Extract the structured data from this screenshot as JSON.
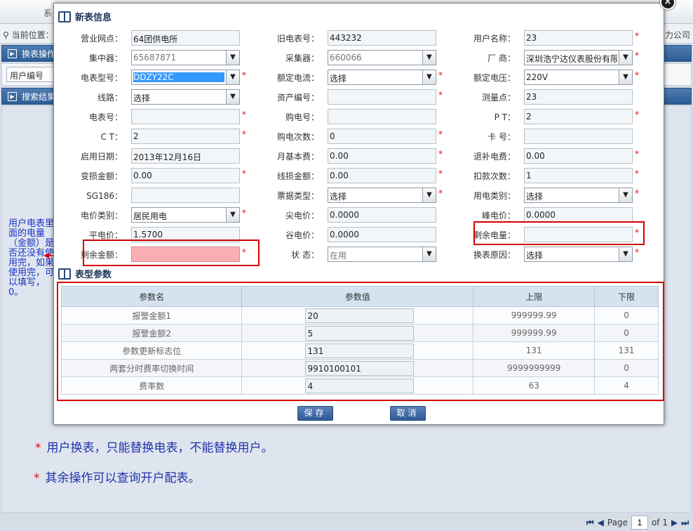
{
  "background": {
    "topbar_text": "系",
    "location_label": "当前位置：",
    "company_text": "力公司",
    "panel_replace": "换表操作",
    "field_user_no": "用户编号",
    "panel_search": "搜索结果",
    "annotation": "用户电表里面的电量（金额）是否还没有使用完，如果使用完，可以填写，0。",
    "note1": "用户换表，只能替换电表，不能替换用户。",
    "note2": "其余操作可以查询开户配表。",
    "pager": {
      "page_label": "Page",
      "page_value": "1",
      "of_label": "of 1"
    }
  },
  "modal": {
    "section1_title": "新表信息",
    "section2_title": "表型参数",
    "close_symbol": "×",
    "col1": [
      {
        "label": "营业网点：",
        "value": "64团供电所",
        "type": "input",
        "req": false
      },
      {
        "label": "集中器：",
        "value": "65687871",
        "type": "select",
        "gray": true,
        "req": false
      },
      {
        "label": "电表型号：",
        "value": "DDZY22C",
        "type": "select",
        "highlight": true,
        "req": true
      },
      {
        "label": "线路：",
        "value": "选择",
        "type": "select",
        "req": false
      },
      {
        "label": "电表号：",
        "value": "",
        "type": "input",
        "req": true
      },
      {
        "label": "C T：",
        "value": "2",
        "type": "input",
        "req": true
      },
      {
        "label": "启用日期：",
        "value": "2013年12月16日",
        "type": "input",
        "req": false
      },
      {
        "label": "变损金额：",
        "value": "0.00",
        "type": "input",
        "req": true
      },
      {
        "label": "SG186：",
        "value": "",
        "type": "input",
        "req": false
      },
      {
        "label": "电价类别：",
        "value": "居民用电",
        "type": "select",
        "req": true
      },
      {
        "label": "平电价：",
        "value": "1.5700",
        "type": "input",
        "req": false
      },
      {
        "label": "剩余金额：",
        "value": "",
        "type": "input",
        "pink": true,
        "req": true
      }
    ],
    "col2": [
      {
        "label": "旧电表号：",
        "value": "443232",
        "type": "input",
        "req": false
      },
      {
        "label": "采集器：",
        "value": "660066",
        "type": "select",
        "gray": true,
        "req": false
      },
      {
        "label": "额定电流：",
        "value": "选择",
        "type": "select",
        "req": true
      },
      {
        "label": "资产编号：",
        "value": "",
        "type": "input",
        "req": true
      },
      {
        "label": "购电号：",
        "value": "",
        "type": "input",
        "req": false
      },
      {
        "label": "购电次数：",
        "value": "0",
        "type": "input",
        "req": true
      },
      {
        "label": "月基本费：",
        "value": "0.00",
        "type": "input",
        "req": true
      },
      {
        "label": "线损金额：",
        "value": "0.00",
        "type": "input",
        "req": true
      },
      {
        "label": "票据类型：",
        "value": "选择",
        "type": "select",
        "req": true
      },
      {
        "label": "尖电价：",
        "value": "0.0000",
        "type": "input",
        "req": false
      },
      {
        "label": "谷电价：",
        "value": "0.0000",
        "type": "input",
        "req": false
      },
      {
        "label": "状 态：",
        "value": "在用",
        "type": "select",
        "gray": true,
        "req": false
      }
    ],
    "col3": [
      {
        "label": "用户名称：",
        "value": "23",
        "type": "input",
        "req": true
      },
      {
        "label": "厂 商：",
        "value": "深圳浩宁达仪表股份有限",
        "type": "select",
        "req": true
      },
      {
        "label": "额定电压：",
        "value": "220V",
        "type": "select",
        "req": true
      },
      {
        "label": "测量点：",
        "value": "23",
        "type": "input",
        "req": false
      },
      {
        "label": "P T：",
        "value": "2",
        "type": "input",
        "req": true
      },
      {
        "label": "卡 号：",
        "value": "",
        "type": "input",
        "req": false
      },
      {
        "label": "退补电费：",
        "value": "0.00",
        "type": "input",
        "req": true
      },
      {
        "label": "扣款次数：",
        "value": "1",
        "type": "input",
        "req": true
      },
      {
        "label": "用电类别：",
        "value": "选择",
        "type": "select",
        "req": true
      },
      {
        "label": "峰电价：",
        "value": "0.0000",
        "type": "input",
        "req": false
      },
      {
        "label": "剩余电量：",
        "value": "",
        "type": "input",
        "req": true
      },
      {
        "label": "换表原因：",
        "value": "选择",
        "type": "select",
        "req": true
      }
    ],
    "param_headers": [
      "参数名",
      "参数值",
      "上限",
      "下限"
    ],
    "params": [
      {
        "name": "报警金额1",
        "value": "20",
        "upper": "999999.99",
        "lower": "0"
      },
      {
        "name": "报警金额2",
        "value": "5",
        "upper": "999999.99",
        "lower": "0"
      },
      {
        "name": "参数更新标志位",
        "value": "131",
        "upper": "131",
        "lower": "131"
      },
      {
        "name": "两套分时费率切换时间",
        "value": "9910100101",
        "upper": "9999999999",
        "lower": "0"
      },
      {
        "name": "费率数",
        "value": "4",
        "upper": "63",
        "lower": "4"
      }
    ],
    "save_label": "保存",
    "cancel_label": "取消",
    "required_mark": "*"
  }
}
